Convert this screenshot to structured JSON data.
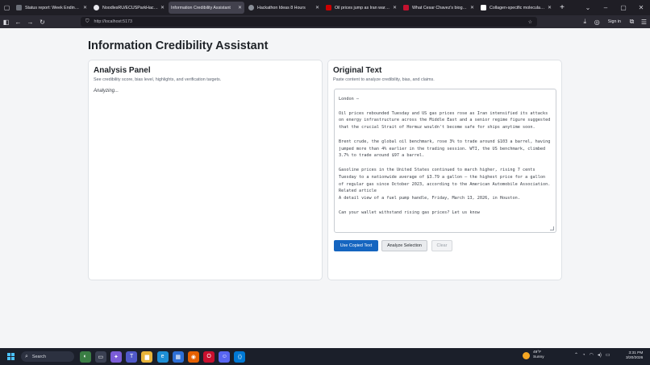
{
  "browser": {
    "tabs": [
      {
        "title": "Status report: Week Ending Ma",
        "color": "#6b6f78",
        "active": false
      },
      {
        "title": "NoodlesRU/ECUSParkHackath",
        "color": "#e8e8ee",
        "active": false
      },
      {
        "title": "Information Credibility Assistant",
        "color": "#42414d",
        "active": true
      },
      {
        "title": "Hackathon Ideas 8 Hours",
        "color": "#8a8f98",
        "active": false
      },
      {
        "title": "Oil prices jump as Iran warns S",
        "color": "#cc0000",
        "active": false
      },
      {
        "title": "What Cesar Chavez's biographi",
        "color": "#c4122f",
        "active": false
      },
      {
        "title": "Collagen-specific molecular ch",
        "color": "#ffffff",
        "active": false
      }
    ],
    "url": "http://localhost:5173",
    "sign_in_label": "Sign in"
  },
  "page": {
    "title": "Information Credibility Assistant"
  },
  "analysis_panel": {
    "heading": "Analysis Panel",
    "subtitle": "See credibility score, bias level, highlights, and verification targets.",
    "status": "Analyzing..."
  },
  "original_text": {
    "heading": "Original Text",
    "subtitle": "Paste content to analyze credibility, bias, and claims.",
    "paragraphs": [
      "London —",
      "Oil prices rebounded Tuesday and US gas prices rose as Iran intensified its attacks on energy infrastructure across the Middle East and a senior regime figure suggested that the crucial Strait of Hormuz wouldn't become safe for ships anytime soon.",
      "Brent crude, the global oil benchmark, rose 3% to trade around $103 a barrel, having jumped more than 4% earlier in the trading session. WTI, the US benchmark, climbed 3.7% to trade around $97 a barrel.",
      "Gasoline prices in the United States continued to march higher, rising 7 cents Tuesday to a nationwide average of $3.79 a gallon – the highest price for a gallon of regular gas since October 2023, according to the American Automobile Association.\nRelated article\nA detail view of a fuel pump handle, Friday, March 13, 2026, in Houston.",
      "Can your wallet withstand rising gas prices? Let us know"
    ],
    "buttons": {
      "use_copied": "Use Copied Text",
      "analyze_selection": "Analyze Selection",
      "clear": "Clear"
    }
  },
  "taskbar": {
    "search_placeholder": "Search",
    "weather_temp": "49°F",
    "weather_desc": "Sunny",
    "time": "3:31 PM",
    "date": "3/20/2026"
  }
}
